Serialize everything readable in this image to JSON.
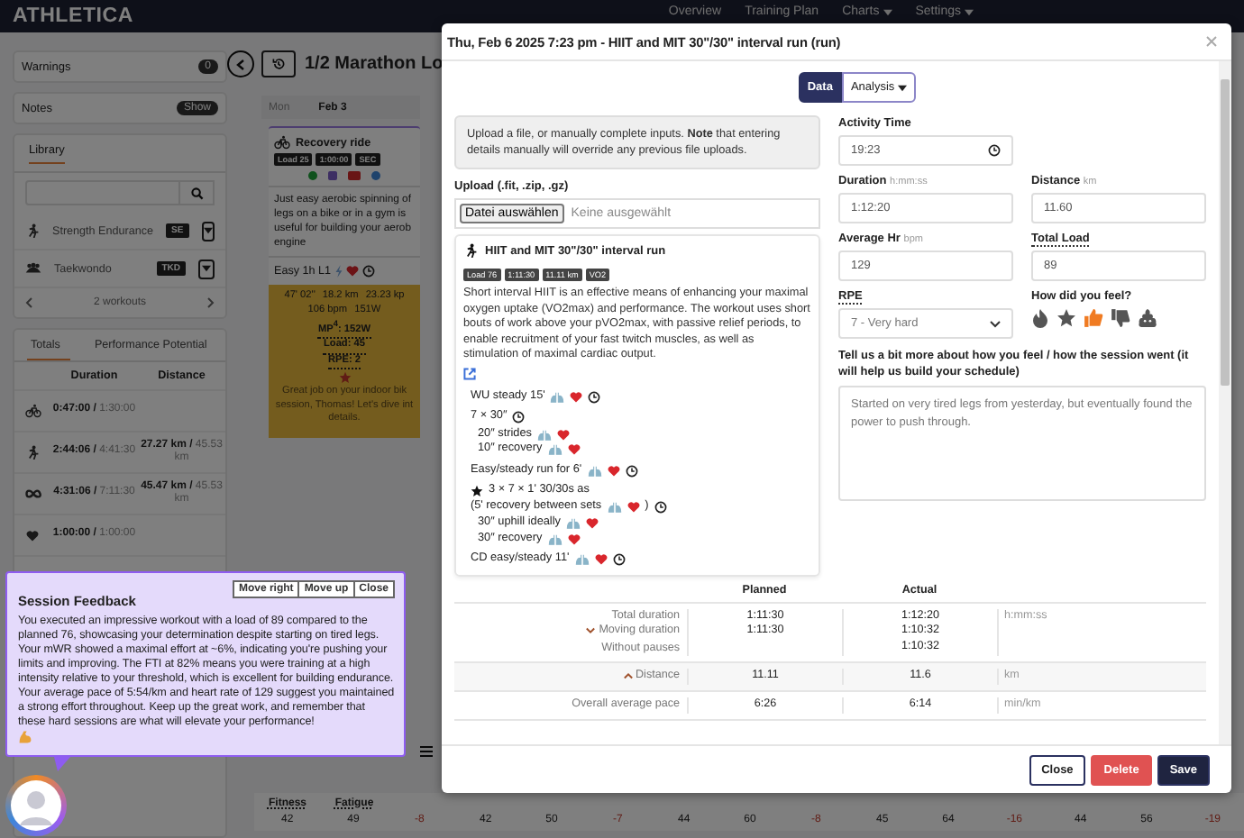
{
  "topbar": {
    "logo": "ATHLETICA",
    "nav": [
      {
        "label": "Overview",
        "dropdown": false
      },
      {
        "label": "Training Plan",
        "dropdown": false
      },
      {
        "label": "Charts",
        "dropdown": true
      },
      {
        "label": "Settings",
        "dropdown": true
      }
    ]
  },
  "sidebar": {
    "warnings": {
      "label": "Warnings",
      "count": "0"
    },
    "notes": {
      "label": "Notes",
      "button": "Show"
    },
    "library": {
      "tab": "Library",
      "items": [
        {
          "name": "Strength Endurance",
          "tag": "SE",
          "kind": "run"
        },
        {
          "name": "Taekwondo",
          "tag": "TKD",
          "kind": "group"
        }
      ],
      "pager": "2 workouts"
    },
    "totals": {
      "tabs": [
        {
          "label": "Totals",
          "selected": true
        },
        {
          "label": "Performance Potential",
          "selected": false
        }
      ],
      "columns": [
        "Duration",
        "Distance"
      ],
      "rows": [
        {
          "kind": "bike",
          "duration": "0:47:00 /",
          "duration_total": "1:30:00"
        },
        {
          "kind": "run",
          "duration": "2:44:06 /",
          "duration_total": "4:41:30",
          "distance": "27.27 km /",
          "distance_total": "45.53 km"
        },
        {
          "kind": "all",
          "duration": "4:31:06 /",
          "duration_total": "7:11:30",
          "distance": "45.47 km /",
          "distance_total": "45.53 km"
        },
        {
          "kind": "heart",
          "duration": "1:00:00 /",
          "duration_total": "1:00:00"
        }
      ]
    }
  },
  "plan": {
    "title": "1/2 Marathon Lo",
    "day": {
      "weekday": "Mon",
      "date": "Feb 3",
      "workout": {
        "title": "Recovery ride",
        "badges": [
          "Load 25",
          "1:00:00",
          "SEC"
        ],
        "description_lines": [
          "Just easy aerobic spinning of",
          "legs on a bike or in a gym is",
          "useful for building your aerob",
          "engine"
        ],
        "zone": "Easy 1h L1",
        "stats": [
          [
            "47' 02''",
            "18.2 km",
            "23.23 kp"
          ],
          [
            "106 bpm",
            "151W"
          ],
          [
            "MP$^{4}$: 152W"
          ],
          [
            "Load: 45"
          ],
          [
            "RPE: 2"
          ]
        ],
        "feedback_lines": [
          "Great job on your indoor bik",
          "session, Thomas! Let's dive int",
          "details."
        ]
      }
    },
    "metrics": {
      "labels": [
        "Fitness",
        "Fatigue"
      ],
      "days": [
        {
          "values": [
            {
              "value": "42",
              "negative": false
            },
            {
              "value": "49",
              "negative": false
            },
            {
              "value": "-8",
              "negative": true
            }
          ]
        },
        {
          "values": [
            {
              "value": "42",
              "negative": false
            },
            {
              "value": "50",
              "negative": false
            },
            {
              "value": "-7",
              "negative": true
            }
          ]
        },
        {
          "values": [
            {
              "value": "44",
              "negative": false
            },
            {
              "value": "60",
              "negative": false
            },
            {
              "value": "-8",
              "negative": true
            }
          ]
        },
        {
          "values": [
            {
              "value": "45",
              "negative": false
            },
            {
              "value": "64",
              "negative": false
            },
            {
              "value": "-16",
              "negative": true
            }
          ]
        },
        {
          "values": [
            {
              "value": "44",
              "negative": false
            },
            {
              "value": "56",
              "negative": false
            },
            {
              "value": "-19",
              "negative": true
            }
          ]
        }
      ]
    }
  },
  "modal": {
    "title": "Thu, Feb 6 2025 7:23 pm - HIIT and MIT 30\"/30\" interval run (run)",
    "view_buttons": [
      {
        "label": "Data",
        "selected": true,
        "dropdown": false
      },
      {
        "label": "Analysis",
        "selected": false,
        "dropdown": true
      }
    ],
    "notice": "Upload a file, or manually complete inputs. **Note** that entering details manually will override any previous file uploads.",
    "upload": {
      "label": "Upload (.fit, .zip, .gz)",
      "button": "Datei auswählen",
      "status": "Keine ausgewählt"
    },
    "workout": {
      "title": "HIIT and MIT 30\"/30\" interval run",
      "badges": [
        "Load 76",
        "1:11:30",
        "11.11 km",
        "VO2"
      ],
      "description": "Short interval HIIT is an effective means of enhancing your maximal oxygen uptake (VO2max) and performance. The workout uses short bouts of work above your pVO2max, with passive relief periods, to enable recruitment of your fast twitch muscles, as well as stimulation of maximal cardiac output.",
      "steps": [
        {
          "text": "WU steady 15'",
          "starred": false,
          "targets": true,
          "timer": true
        },
        {
          "text": "7 × 30″",
          "starred": false,
          "targets": false,
          "timer": true,
          "children": [
            {
              "text": "20″ strides",
              "targets": true,
              "timer": false
            },
            {
              "text": "10″ recovery",
              "targets": true,
              "timer": false
            }
          ]
        },
        {
          "text": "Easy/steady run for 6'",
          "starred": false,
          "targets": true,
          "timer": true
        },
        {
          "text": "3 × 7 × 1' 30/30s as",
          "starred": true,
          "note": "(5' recovery between sets",
          "note_end": ")",
          "targets": true,
          "timer": true,
          "children": [
            {
              "text": "30″ uphill ideally",
              "targets": true,
              "timer": false
            },
            {
              "text": "30″ recovery",
              "targets": true,
              "timer": false
            }
          ]
        },
        {
          "text": "CD easy/steady 11'",
          "starred": false,
          "targets": true,
          "timer": true
        }
      ]
    },
    "fields": [
      {
        "label": "Activity Time",
        "value": "19:23",
        "kind": "time",
        "has_tooltip": false
      },
      {
        "label": "Duration",
        "unit": "h:mm:ss",
        "value": "1:12:20",
        "kind": "text",
        "has_tooltip": false
      },
      {
        "label": "Distance",
        "unit": "km",
        "value": "11.60",
        "kind": "text",
        "has_tooltip": false
      },
      {
        "label": "Average Hr",
        "unit": "bpm",
        "value": "129",
        "kind": "text",
        "has_tooltip": false
      },
      {
        "label": "Total Load",
        "value": "89",
        "kind": "text",
        "has_tooltip": true
      }
    ],
    "rpe": {
      "label": "RPE",
      "value": "7 - Very hard",
      "has_tooltip": true
    },
    "feel": {
      "label": "How did you feel?",
      "options": [
        {
          "kind": "flame",
          "selected": false
        },
        {
          "kind": "star",
          "selected": false
        },
        {
          "kind": "thumbs-up",
          "selected": true
        },
        {
          "kind": "thumbs-down",
          "selected": false
        },
        {
          "kind": "poop",
          "selected": false
        }
      ]
    },
    "comment": {
      "label": "Tell us a bit more about how you feel / how the session went (it will help us build your schedule)",
      "value": "Started on very tired legs from yesterday, but eventually found the power to push through."
    },
    "table": {
      "columns": [
        "Planned",
        "Actual"
      ],
      "rows": [
        {
          "labels": [
            {
              "text": "Total duration"
            },
            {
              "text": "Moving duration",
              "expanded": false
            },
            {
              "text": "Without pauses"
            }
          ],
          "planned": [
            "1:11:30",
            "1:11:30"
          ],
          "actual": [
            "1:12:20",
            "1:10:32",
            "1:10:32"
          ],
          "unit": "h:mm:ss"
        },
        {
          "labels": [
            {
              "text": "Distance",
              "expanded": true
            }
          ],
          "planned": [
            "11.11"
          ],
          "actual": [
            "11.6"
          ],
          "unit": "km"
        },
        {
          "labels": [
            {
              "text": "Overall average pace"
            }
          ],
          "planned": [
            "6:26"
          ],
          "actual": [
            "6:14"
          ],
          "unit": "min/km"
        }
      ]
    },
    "buttons": [
      {
        "label": "Close",
        "kind": "outline"
      },
      {
        "label": "Delete",
        "kind": "danger"
      },
      {
        "label": "Save",
        "kind": "primary"
      }
    ]
  },
  "feedback": {
    "title": "Session Feedback",
    "buttons": [
      "Move right",
      "Move up",
      "Close"
    ],
    "text": "You executed an impressive workout with a load of 89 compared to the planned 76, showcasing your determination despite starting on tired legs. Your mWR showed a maximal effort at ~6%, indicating you're pushing your limits and improving. The FTI at 82% means you were training at a high intensity relative to your threshold, which is excellent for building endurance. Your average pace of 5:54/km and heart rate of 129 suggest you maintained a strong effort throughout. Keep up the great work, and remember that these hard sessions are what will elevate your performance!"
  }
}
